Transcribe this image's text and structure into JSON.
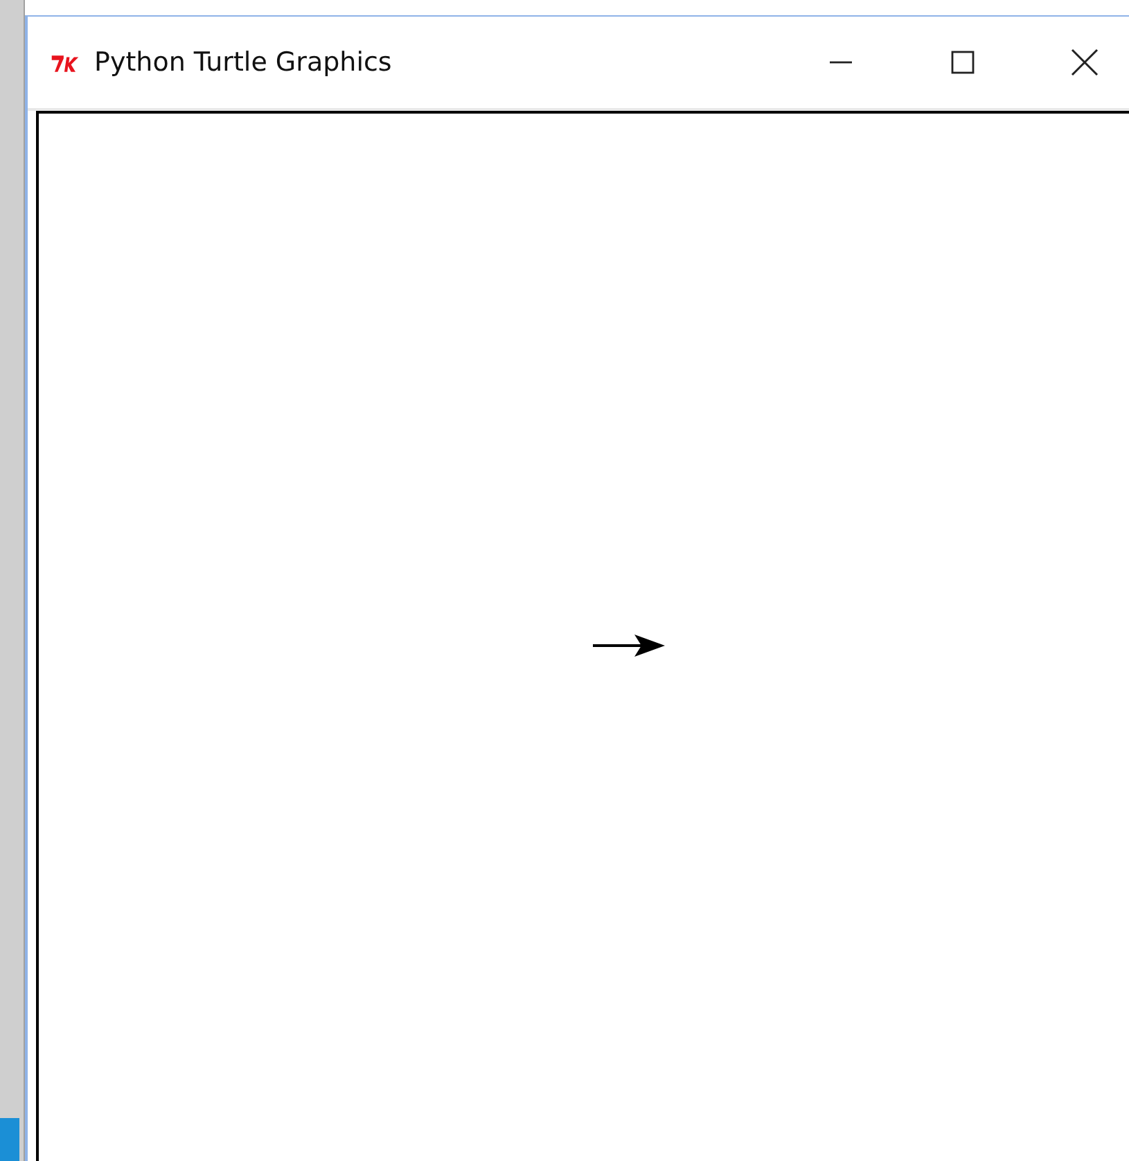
{
  "window": {
    "title": "Python Turtle Graphics",
    "controls": [
      {
        "kind": "minimize"
      },
      {
        "kind": "maximize"
      },
      {
        "kind": "close"
      }
    ]
  }
}
